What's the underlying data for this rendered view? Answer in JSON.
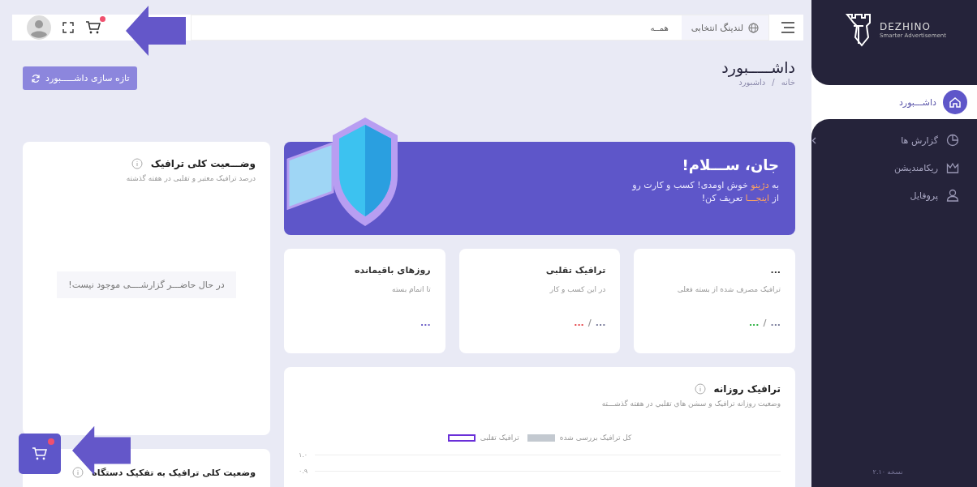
{
  "sidebar": {
    "logo": {
      "name": "DEZHINO",
      "tagline": "Smarter Advertisement"
    },
    "items": [
      {
        "label": "داشـــبورد",
        "selected": true,
        "expandable": false
      },
      {
        "label": "گزارش ها",
        "selected": false,
        "expandable": true
      },
      {
        "label": "ریکامندیشن",
        "selected": false,
        "expandable": false
      },
      {
        "label": "پروفایل",
        "selected": false,
        "expandable": false
      }
    ],
    "version": "نسخه ۲.۱۰"
  },
  "header": {
    "landing_label": "لندینگ انتخابی",
    "landing_value": "همــه",
    "cart_has_notification": true
  },
  "page": {
    "title": "داشـــــبورد",
    "breadcrumb": [
      "خانه",
      "داشبورد"
    ],
    "breadcrumb_separator": "/",
    "refresh_button": "تازه سازی داشـــــبورد"
  },
  "welcome": {
    "title": "جان، ســـلام!",
    "lines": [
      {
        "before": "به ",
        "link": "دژینو",
        "after": " خوش اومدی! کسب و کارت رو"
      },
      {
        "before": "از ",
        "link": "اینجـــا",
        "after": " تعریف کن!"
      }
    ]
  },
  "stats": [
    {
      "title": "...",
      "subtitle": "ترافیک مصرف شده از بسته فعلی",
      "separator": "/",
      "values": [
        {
          "text": "...",
          "color": "#7a7d9c"
        },
        {
          "text": "...",
          "color": "#2fb344"
        }
      ]
    },
    {
      "title": "ترافیک تقلبی",
      "subtitle": "در این کسب و کار",
      "separator": "/",
      "values": [
        {
          "text": "...",
          "color": "#7a7d9c"
        },
        {
          "text": "...",
          "color": "#e5484d"
        }
      ]
    },
    {
      "title": "روزهای باقیمانده",
      "subtitle": "تا اتمام بسته",
      "values": [
        {
          "text": "...",
          "color": "#6c5fc7"
        }
      ]
    }
  ],
  "daily_traffic": {
    "title": "ترافیک روزانه",
    "subtitle": "وضعیت روزانه ترافیک و سشن هاي تقلبي در هفته گذشـــته",
    "legend": [
      {
        "label": "کل ترافیک بررسی شده",
        "color": "#c3c9d0",
        "kind": "filled"
      },
      {
        "label": "ترافیک تقلبی",
        "color": "#6a2fd8",
        "kind": "outline"
      }
    ],
    "y_labels": [
      "۱.۰",
      "۰.۹"
    ]
  },
  "traffic_status": {
    "title": "وضـــعیت کلی ترافیک",
    "subtitle": "درصد ترافیک معتبر و تقلبی در هفته گذشته",
    "empty_message": "در حال حاضـــر گزارشــــی موجود نیست!"
  },
  "device_status": {
    "title": "وضعیت کلی ترافیک به تفکیک دستگاه"
  },
  "floating_cart": {
    "has_notification": true
  }
}
